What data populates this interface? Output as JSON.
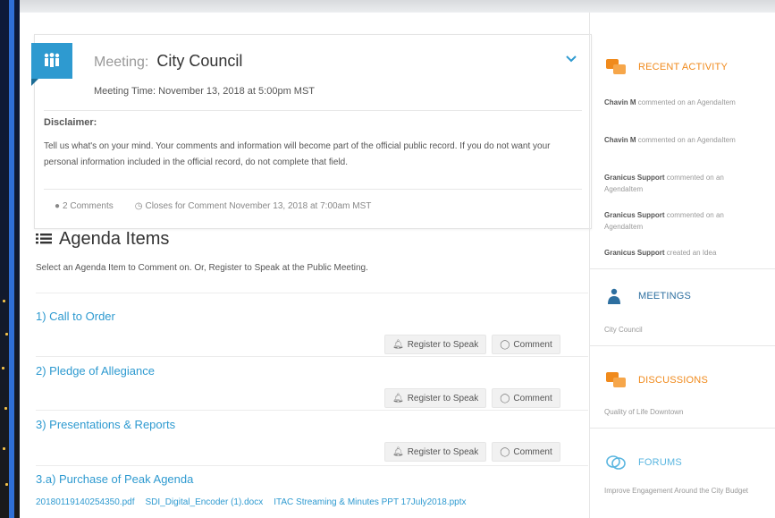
{
  "meeting": {
    "label": "Meeting:",
    "title": "City Council",
    "time": "Meeting Time: November 13, 2018 at 5:00pm MST",
    "disclaimer_title": "Disclaimer:",
    "disclaimer_text": "Tell us what's on your mind. Your comments and information will become part of the official public record. If you do not want your personal information included in the official record, do not complete that field.",
    "comments": "2 Comments",
    "closes": "Closes for Comment November 13, 2018 at 7:00am MST"
  },
  "agenda": {
    "heading": "Agenda Items",
    "subtitle": "Select an Agenda Item to Comment on. Or, Register to Speak at the Public Meeting.",
    "register_label": "Register to Speak",
    "comment_label": "Comment",
    "items": [
      {
        "title": "1) Call to Order"
      },
      {
        "title": "2) Pledge of Allegiance"
      },
      {
        "title": "3) Presentations & Reports"
      },
      {
        "title": "3.a) Purchase of Peak Agenda"
      }
    ],
    "attachments": [
      "20180119140254350.pdf",
      "SDI_Digital_Encoder (1).docx",
      "ITAC Streaming & Minutes PPT 17July2018.pptx"
    ]
  },
  "sidebar": {
    "recent_activity": {
      "title": "RECENT ACTIVITY",
      "items": [
        {
          "user": "Chavin M",
          "text": "commented on an AgendaItem"
        },
        {
          "user": "Chavin M",
          "text": "commented on an AgendaItem"
        },
        {
          "user": "Granicus Support",
          "text": "commented on an AgendaItem"
        },
        {
          "user": "Granicus Support",
          "text": "commented on an AgendaItem"
        },
        {
          "user": "Granicus Support",
          "text": "created an Idea"
        }
      ]
    },
    "meetings": {
      "title": "MEETINGS",
      "item": "City Council"
    },
    "discussions": {
      "title": "DISCUSSIONS",
      "item": "Quality of Life Downtown"
    },
    "forums": {
      "title": "FORUMS",
      "item": "Improve Engagement Around the City Budget"
    }
  },
  "colors": {
    "accent_blue": "#2e9ad0",
    "accent_orange": "#f08a1c",
    "sidebar_blue": "#2f6fd6"
  }
}
